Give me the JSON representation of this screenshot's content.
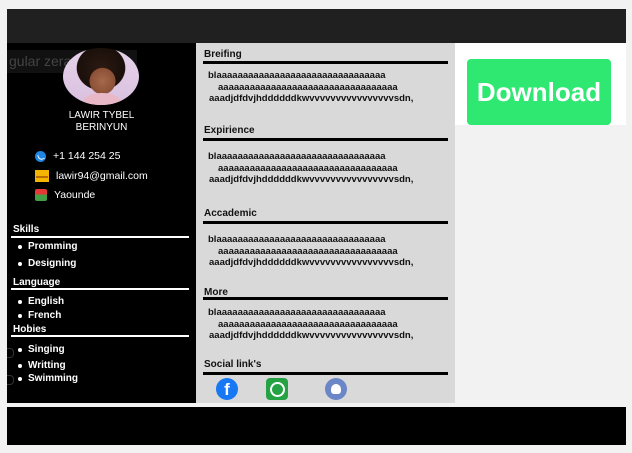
{
  "sidebar": {
    "ghost_label": "gular zerap",
    "name_line1": "LAWIR TYBEL",
    "name_line2": "BERINYUN",
    "contacts": {
      "phone": "+1  144 254 25",
      "email": "lawir94@gmail.com",
      "location": "Yaounde"
    },
    "skills_title": "Skills",
    "skills": [
      "Promming",
      "Designing"
    ],
    "language_title": "Language",
    "languages": [
      "English",
      "French"
    ],
    "hobies_title": "Hobies",
    "hobies": [
      "Singing",
      "Writting",
      "Swimming"
    ]
  },
  "main": {
    "sections": [
      {
        "title": "Breifing",
        "lines": [
          "blaaaaaaaaaaaaaaaaaaaaaaaaaaaaaaaa",
          "aaaaaaaaaaaaaaaaaaaaaaaaaaaaaaaaaa",
          "aaadjdfdvjhddddddkwvvvvvvvvvvvvvvvvsdn,"
        ]
      },
      {
        "title": "Expirience",
        "lines": [
          "blaaaaaaaaaaaaaaaaaaaaaaaaaaaaaaaa",
          "aaaaaaaaaaaaaaaaaaaaaaaaaaaaaaaaaa",
          "aaadjdfdvjhddddddkwvvvvvvvvvvvvvvvvsdn,"
        ]
      },
      {
        "title": "Accademic",
        "lines": [
          "blaaaaaaaaaaaaaaaaaaaaaaaaaaaaaaaa",
          "aaaaaaaaaaaaaaaaaaaaaaaaaaaaaaaaaa",
          "aaadjdfdvjhddddddkwvvvvvvvvvvvvvvvvsdn,"
        ]
      },
      {
        "title": "More",
        "lines": [
          "blaaaaaaaaaaaaaaaaaaaaaaaaaaaaaaaa",
          "aaaaaaaaaaaaaaaaaaaaaaaaaaaaaaaaaa",
          "aaadjdfdvjhddddddkwvvvvvvvvvvvvvvvvsdn,"
        ]
      }
    ],
    "social_title": "Social link's",
    "social_icons": [
      "facebook-icon",
      "whatsapp-icon",
      "github-icon"
    ],
    "facebook_glyph": "f"
  },
  "download_label": "Download",
  "colors": {
    "download": "#2ee872",
    "sidebar": "#000000",
    "main": "#d9d9d9"
  }
}
